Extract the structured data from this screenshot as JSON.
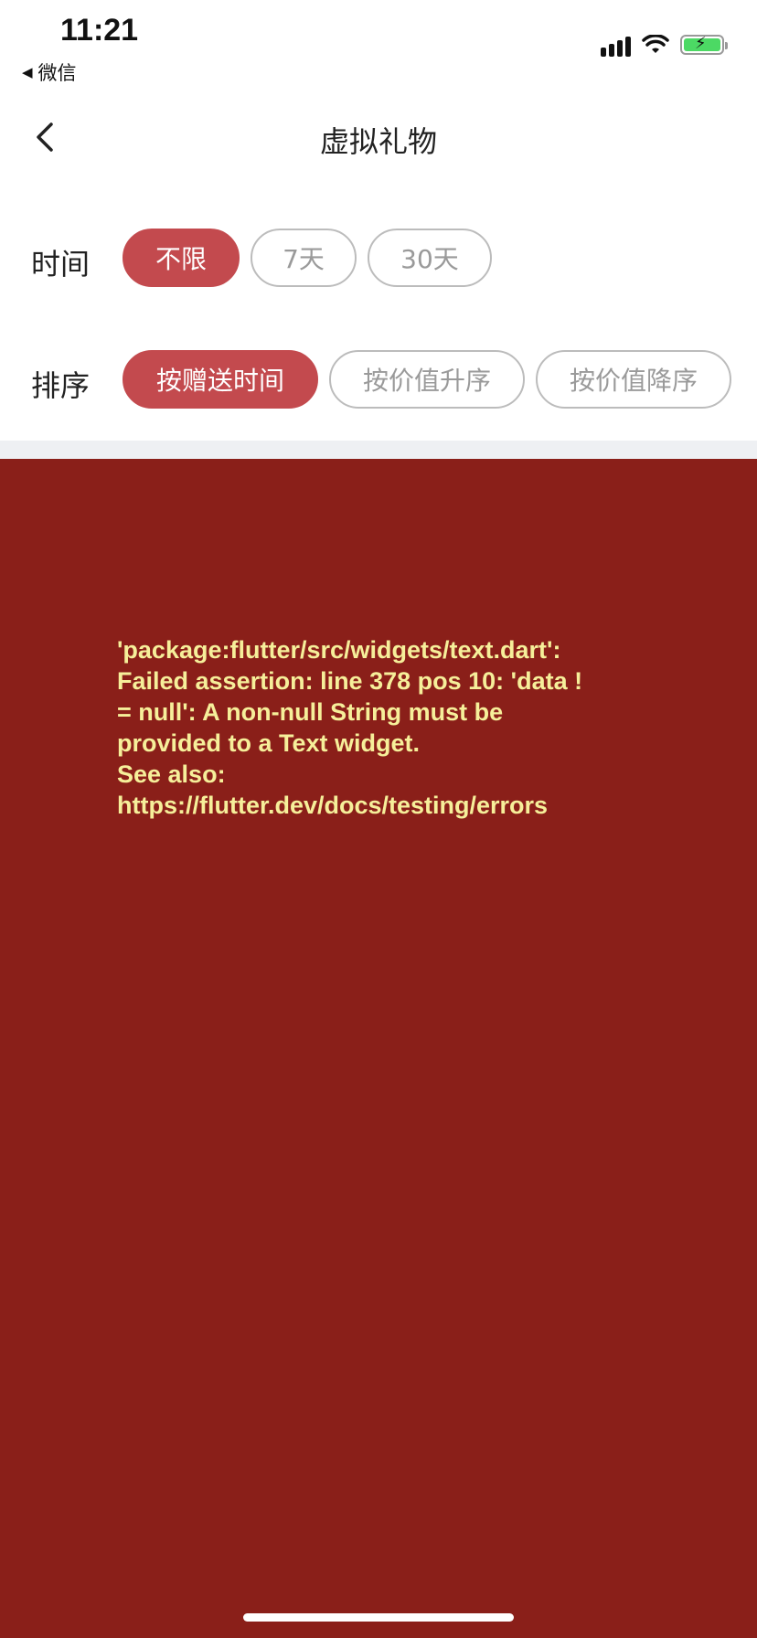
{
  "status_bar": {
    "time": "11:21",
    "back_app_label": "微信"
  },
  "nav": {
    "title": "虚拟礼物"
  },
  "filters": {
    "time": {
      "label": "时间",
      "options": [
        "不限",
        "7天",
        "30天"
      ],
      "selected": "不限"
    },
    "sort": {
      "label": "排序",
      "options": [
        "按赠送时间",
        "按价值升序",
        "按价值降序"
      ],
      "selected": "按赠送时间"
    }
  },
  "error": {
    "lines": [
      "'package:flutter/src/widgets/text.dart':",
      "Failed assertion: line 378 pos 10: 'data !",
      "= null': A non-null String must be",
      "provided to a Text widget.",
      "See also:",
      "https://flutter.dev/docs/testing/errors"
    ]
  },
  "colors": {
    "accent": "#c34a4e",
    "error_background": "#8a1f19",
    "error_text": "#f6ef9a",
    "divider": "#eef0f3"
  }
}
